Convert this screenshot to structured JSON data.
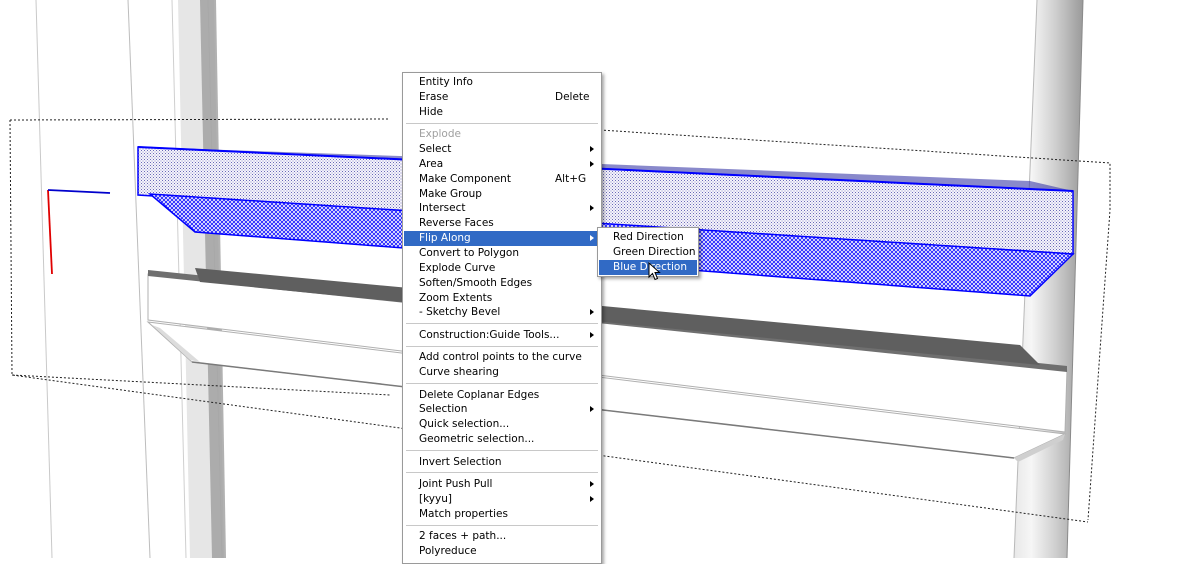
{
  "context_menu": {
    "items": [
      {
        "label": "Entity Info",
        "shortcut": "",
        "submenu": false,
        "disabled": false,
        "highlighted": false,
        "name": "menu-item-entity-info"
      },
      {
        "label": "Erase",
        "shortcut": "Delete",
        "submenu": false,
        "disabled": false,
        "highlighted": false,
        "name": "menu-item-erase"
      },
      {
        "label": "Hide",
        "shortcut": "",
        "submenu": false,
        "disabled": false,
        "highlighted": false,
        "name": "menu-item-hide"
      },
      {
        "separator": true
      },
      {
        "label": "Explode",
        "shortcut": "",
        "submenu": false,
        "disabled": true,
        "highlighted": false,
        "name": "menu-item-explode"
      },
      {
        "label": "Select",
        "shortcut": "",
        "submenu": true,
        "disabled": false,
        "highlighted": false,
        "name": "menu-item-select"
      },
      {
        "label": "Area",
        "shortcut": "",
        "submenu": true,
        "disabled": false,
        "highlighted": false,
        "name": "menu-item-area"
      },
      {
        "label": "Make Component",
        "shortcut": "Alt+G",
        "submenu": false,
        "disabled": false,
        "highlighted": false,
        "name": "menu-item-make-component"
      },
      {
        "label": "Make Group",
        "shortcut": "",
        "submenu": false,
        "disabled": false,
        "highlighted": false,
        "name": "menu-item-make-group"
      },
      {
        "label": "Intersect",
        "shortcut": "",
        "submenu": true,
        "disabled": false,
        "highlighted": false,
        "name": "menu-item-intersect"
      },
      {
        "label": "Reverse Faces",
        "shortcut": "",
        "submenu": false,
        "disabled": false,
        "highlighted": false,
        "name": "menu-item-reverse-faces"
      },
      {
        "label": "Flip Along",
        "shortcut": "",
        "submenu": true,
        "disabled": false,
        "highlighted": true,
        "name": "menu-item-flip-along"
      },
      {
        "label": "Convert to Polygon",
        "shortcut": "",
        "submenu": false,
        "disabled": false,
        "highlighted": false,
        "name": "menu-item-convert-to-polygon"
      },
      {
        "label": "Explode Curve",
        "shortcut": "",
        "submenu": false,
        "disabled": false,
        "highlighted": false,
        "name": "menu-item-explode-curve"
      },
      {
        "label": "Soften/Smooth Edges",
        "shortcut": "",
        "submenu": false,
        "disabled": false,
        "highlighted": false,
        "name": "menu-item-soften-smooth-edges"
      },
      {
        "label": "Zoom Extents",
        "shortcut": "",
        "submenu": false,
        "disabled": false,
        "highlighted": false,
        "name": "menu-item-zoom-extents"
      },
      {
        "label": "- Sketchy Bevel",
        "shortcut": "",
        "submenu": true,
        "disabled": false,
        "highlighted": false,
        "name": "menu-item-sketchy-bevel"
      },
      {
        "separator": true
      },
      {
        "label": "Construction:Guide Tools...",
        "shortcut": "",
        "submenu": true,
        "disabled": false,
        "highlighted": false,
        "name": "menu-item-construction-guide-tools"
      },
      {
        "separator": true
      },
      {
        "label": "Add control points to the curve",
        "shortcut": "",
        "submenu": false,
        "disabled": false,
        "highlighted": false,
        "name": "menu-item-add-control-points"
      },
      {
        "label": "Curve shearing",
        "shortcut": "",
        "submenu": false,
        "disabled": false,
        "highlighted": false,
        "name": "menu-item-curve-shearing"
      },
      {
        "separator": true
      },
      {
        "label": "Delete Coplanar Edges",
        "shortcut": "",
        "submenu": false,
        "disabled": false,
        "highlighted": false,
        "name": "menu-item-delete-coplanar-edges"
      },
      {
        "label": "Selection",
        "shortcut": "",
        "submenu": true,
        "disabled": false,
        "highlighted": false,
        "name": "menu-item-selection"
      },
      {
        "label": "Quick selection...",
        "shortcut": "",
        "submenu": false,
        "disabled": false,
        "highlighted": false,
        "name": "menu-item-quick-selection"
      },
      {
        "label": "Geometric selection...",
        "shortcut": "",
        "submenu": false,
        "disabled": false,
        "highlighted": false,
        "name": "menu-item-geometric-selection"
      },
      {
        "separator": true
      },
      {
        "label": "Invert Selection",
        "shortcut": "",
        "submenu": false,
        "disabled": false,
        "highlighted": false,
        "name": "menu-item-invert-selection"
      },
      {
        "separator": true
      },
      {
        "label": "Joint Push Pull",
        "shortcut": "",
        "submenu": true,
        "disabled": false,
        "highlighted": false,
        "name": "menu-item-joint-push-pull"
      },
      {
        "label": "[kyyu]",
        "shortcut": "",
        "submenu": true,
        "disabled": false,
        "highlighted": false,
        "name": "menu-item-kyyu"
      },
      {
        "label": "Match properties",
        "shortcut": "",
        "submenu": false,
        "disabled": false,
        "highlighted": false,
        "name": "menu-item-match-properties"
      },
      {
        "separator": true
      },
      {
        "label": "2 faces + path...",
        "shortcut": "",
        "submenu": false,
        "disabled": false,
        "highlighted": false,
        "name": "menu-item-2-faces-path"
      },
      {
        "label": "Polyreduce",
        "shortcut": "",
        "submenu": false,
        "disabled": false,
        "highlighted": false,
        "name": "menu-item-polyreduce"
      }
    ]
  },
  "flip_submenu": {
    "items": [
      {
        "label": "Red Direction",
        "highlighted": false,
        "name": "submenu-item-red-direction"
      },
      {
        "label": "Green Direction",
        "highlighted": false,
        "name": "submenu-item-green-direction"
      },
      {
        "label": "Blue Direction",
        "highlighted": true,
        "name": "submenu-item-blue-direction"
      }
    ]
  },
  "colors": {
    "selection_blue": "#0000ff",
    "menu_highlight": "#316ac5",
    "axis_red": "#e00000",
    "axis_blue": "#0000cc",
    "disabled_text": "#a0a0a0"
  }
}
